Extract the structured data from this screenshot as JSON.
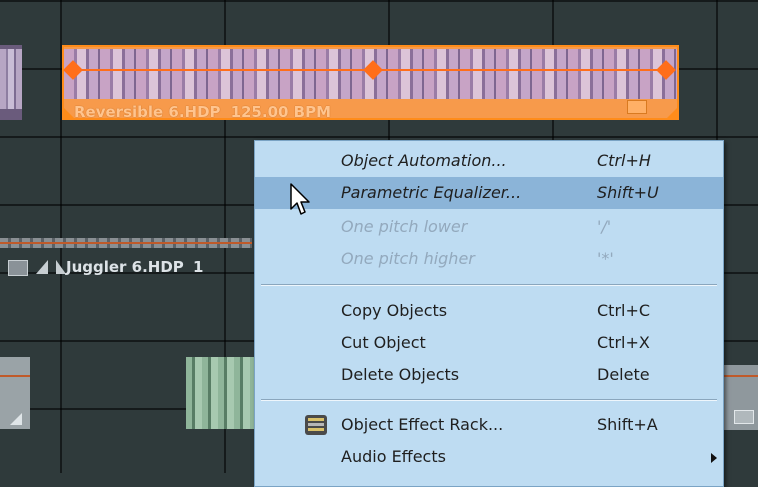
{
  "timeline": {
    "clips": {
      "reversible": {
        "name": "Reversible 6.HDP",
        "bpm": "125.00 BPM"
      },
      "juggler": {
        "name": "Juggler 6.HDP",
        "suffix": "1"
      }
    }
  },
  "context_menu": {
    "items": [
      {
        "label": "Object Automation...",
        "shortcut": "Ctrl+H",
        "style": "italic",
        "state": "normal"
      },
      {
        "label": "Parametric Equalizer...",
        "shortcut": "Shift+U",
        "style": "italic",
        "state": "highlighted"
      },
      {
        "label": "One pitch lower",
        "shortcut": "'/'",
        "style": "italic",
        "state": "disabled"
      },
      {
        "label": "One pitch higher",
        "shortcut": "'*'",
        "style": "italic",
        "state": "disabled"
      },
      {
        "label": "Copy Objects",
        "shortcut": "Ctrl+C",
        "style": "normal",
        "state": "normal"
      },
      {
        "label": "Cut Object",
        "shortcut": "Ctrl+X",
        "style": "normal",
        "state": "normal"
      },
      {
        "label": "Delete Objects",
        "shortcut": "Delete",
        "style": "normal",
        "state": "normal"
      },
      {
        "label": "Object Effect Rack...",
        "shortcut": "Shift+A",
        "style": "normal",
        "state": "normal",
        "icon": "effect-rack-icon"
      },
      {
        "label": "Audio Effects",
        "shortcut": "",
        "style": "normal",
        "state": "normal",
        "submenu": true
      }
    ]
  },
  "colors": {
    "clip_orange": "#f79a4b",
    "menu_bg": "#bedcf2",
    "menu_highlight": "#8bb4d8",
    "disabled_text": "#93a9bd"
  }
}
